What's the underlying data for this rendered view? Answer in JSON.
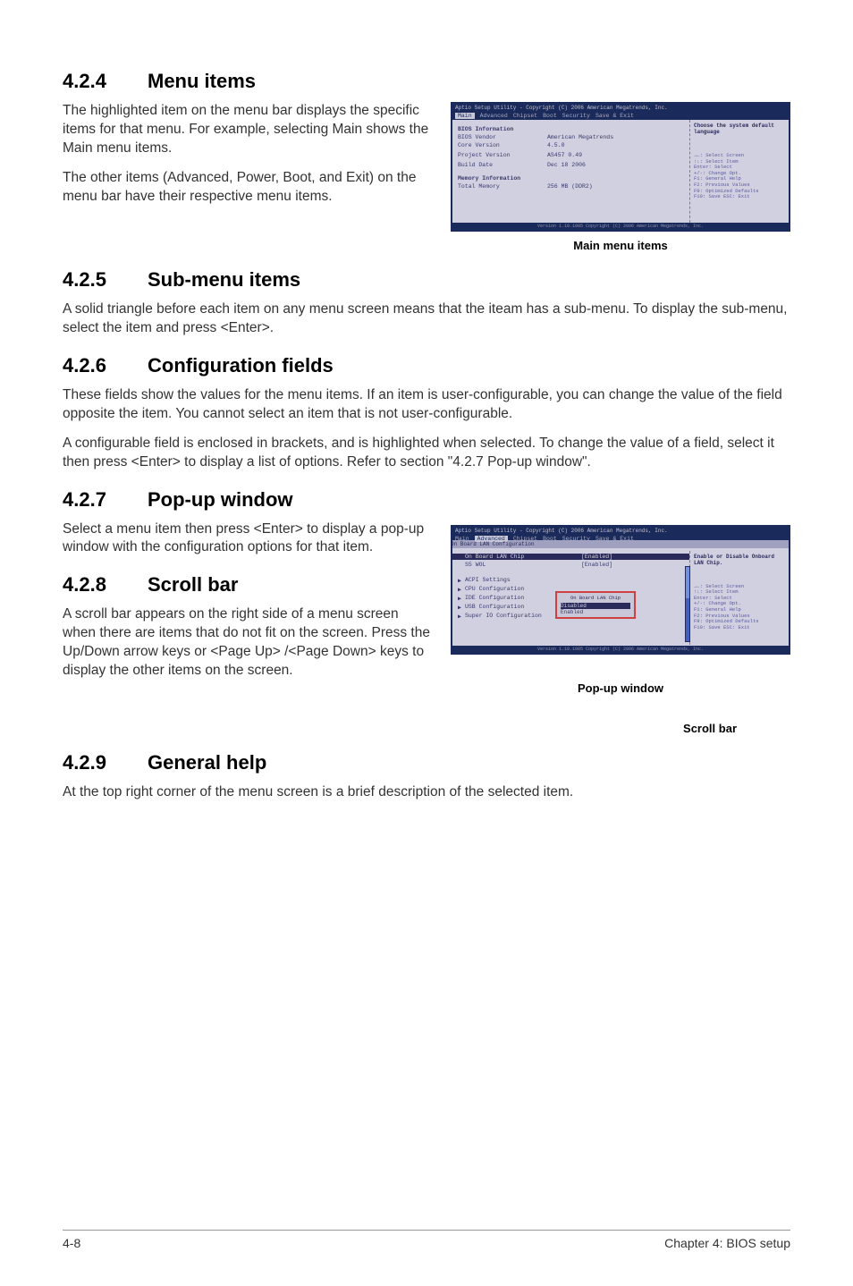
{
  "sections": {
    "menu_items": {
      "num": "4.2.4",
      "title": "Menu items",
      "p1": "The highlighted item on the menu bar displays the specific items for that menu. For example, selecting Main shows the Main menu items.",
      "p2": "The other items (Advanced, Power, Boot, and Exit) on the menu bar have their respective menu items."
    },
    "submenu": {
      "num": "4.2.5",
      "title": "Sub-menu items",
      "p1": "A solid triangle before each item on any menu screen means that the iteam has a sub-menu. To display the sub-menu, select the item and press <Enter>."
    },
    "config": {
      "num": "4.2.6",
      "title": "Configuration fields",
      "p1": "These fields show the values for the menu items. If an item is user-configurable, you can change the value of the field opposite the item. You cannot select an item that is not user-configurable.",
      "p2": "A configurable field is enclosed in brackets, and is highlighted when selected. To change the value of a field, select it then press <Enter> to display a list of options. Refer to section \"4.2.7 Pop-up window\"."
    },
    "popup": {
      "num": "4.2.7",
      "title": "Pop-up window",
      "p1": "Select a menu item then press <Enter> to display a pop-up window with the configuration options for that item."
    },
    "scrollbar": {
      "num": "4.2.8",
      "title": "Scroll bar",
      "p1": "A scroll bar appears on the right side of a menu screen when there are items that do not fit on the screen. Press the Up/Down arrow keys or <Page Up> /<Page Down> keys to display the other items on the screen."
    },
    "genhelp": {
      "num": "4.2.9",
      "title": "General help",
      "p1": "At the top right corner of the menu screen is a brief description of the selected item."
    }
  },
  "bios1": {
    "titlebar": "Aptio Setup Utility - Copyright (C) 2006 American Megatrends, Inc.",
    "tabs": [
      "Main",
      "Advanced",
      "Chipset",
      "Boot",
      "Security",
      "Save & Exit"
    ],
    "section_bios_info": "BIOS Information",
    "vendor_label": "BIOS Vendor",
    "vendor_value": "American Megatrends",
    "core_label": "Core Version",
    "core_value": "4.5.0",
    "project_label": "Project Version",
    "project_value": "AS457 0.49",
    "build_label": "Build Date",
    "build_value": "Dec 18 2006",
    "section_memory": "Memory Information",
    "total_mem_label": "Total Memory",
    "total_mem_value": "256 MB (DDR2)",
    "help_text": "Choose the system default language",
    "keys": "→←: Select Screen\n↑↓: Select Item\nEnter: Select\n+/-: Change Opt.\nF1: General Help\nF2: Previous Values\nF9: Optimized Defaults\nF10: Save  ESC: Exit",
    "footer": "Version 1.10.1085 Copyright (C) 2006 American Megatrends, Inc.",
    "caption": "Main menu items"
  },
  "bios2": {
    "titlebar": "Aptio Setup Utility - Copyright (C) 2006 American Megatrends, Inc.",
    "tabs": [
      "Main",
      "Advanced",
      "Chipset",
      "Boot",
      "Security",
      "Save & Exit"
    ],
    "breadcrumb": "On Board LAN Configuration",
    "item1_label": "On Board LAN Chip",
    "item1_value": "[Enabled]",
    "item2_label": "S5 WOL",
    "item2_value": "[Enabled]",
    "item3": "ACPI Settings",
    "item4": "CPU Configuration",
    "item5": "IDE Configuration",
    "item6": "USB Configuration",
    "item7": "Super IO Configuration",
    "popup_title": "On Board LAN Chip",
    "popup_opt1": "Disabled",
    "popup_opt2": "Enabled",
    "help_text": "Enable or Disable Onboard LAN Chip.",
    "keys": "→←: Select Screen\n↑↓: Select Item\nEnter: Select\n+/-: Change Opt.\nF1: General Help\nF2: Previous Values\nF9: Optimized Defaults\nF10: Save  ESC: Exit",
    "footer": "Version 1.10.1085 Copyright (C) 2006 American Megatrends, Inc.",
    "callout1": "Pop-up window",
    "callout2": "Scroll bar"
  },
  "footer": {
    "page": "4-8",
    "chapter": "Chapter 4: BIOS setup"
  }
}
